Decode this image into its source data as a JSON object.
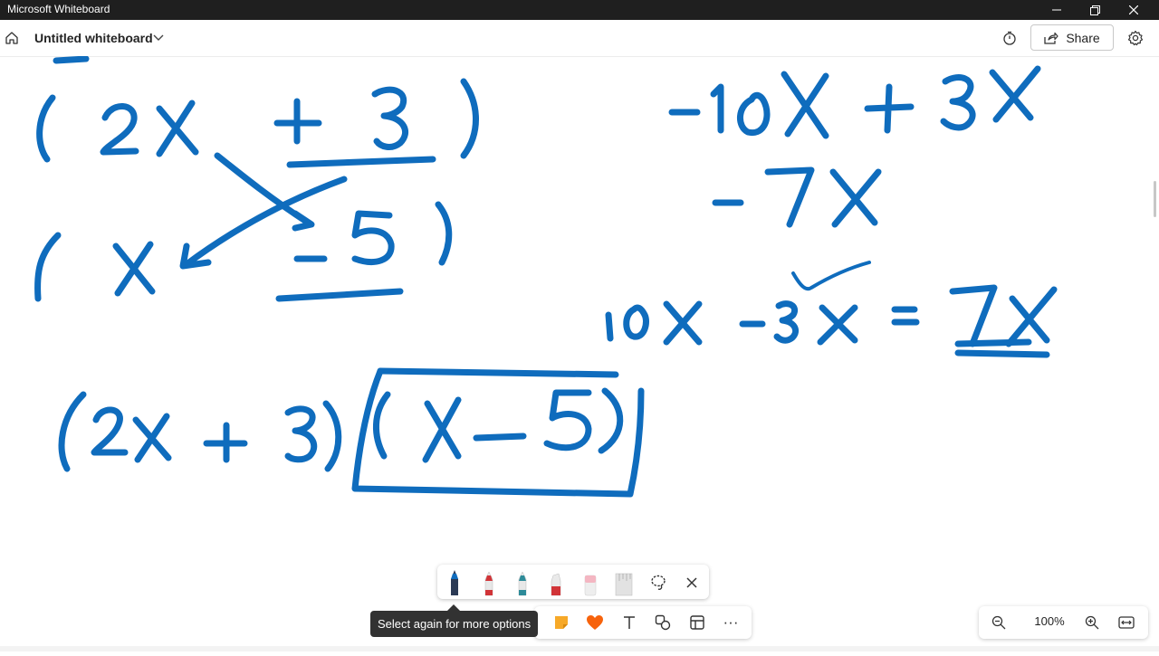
{
  "window": {
    "title": "Microsoft Whiteboard",
    "controls": [
      "minimize-icon",
      "restore-icon",
      "close-icon"
    ]
  },
  "header": {
    "board_title": "Untitled whiteboard",
    "share_label": "Share",
    "icons": [
      "home-icon",
      "chevron-down-icon",
      "timer-icon",
      "share-icon",
      "gear-icon"
    ]
  },
  "canvas": {
    "ink_color": "#0f6cbd",
    "drawing": "handwritten math: (2x + 3)(x - 5), -10x + 3x = -7x, 10x - 3x = 7x"
  },
  "pen_toolbar": {
    "pens": [
      {
        "name": "blue-pen",
        "color": "#0f6cbd",
        "selected": true
      },
      {
        "name": "red-pen",
        "color": "#d13438",
        "selected": false
      },
      {
        "name": "teal-pen",
        "color": "#2e8b99",
        "selected": false
      },
      {
        "name": "red-highlighter",
        "color": "#d13438",
        "selected": false
      },
      {
        "name": "eraser",
        "color": "#f4b6c2",
        "selected": false
      },
      {
        "name": "ruler",
        "color": "#d0d0d0",
        "selected": false
      }
    ],
    "tools": [
      "lasso-icon",
      "close-icon"
    ]
  },
  "bottom_toolbar": {
    "tooltip": "Select again for more options",
    "icons": [
      "sticky-note-icon",
      "reaction-heart-icon",
      "text-icon",
      "shapes-icon",
      "template-icon",
      "more-icon"
    ],
    "more_label": "···"
  },
  "zoom": {
    "level": "100%",
    "icons": [
      "zoom-out-icon",
      "zoom-in-icon",
      "fit-to-screen-icon"
    ]
  }
}
